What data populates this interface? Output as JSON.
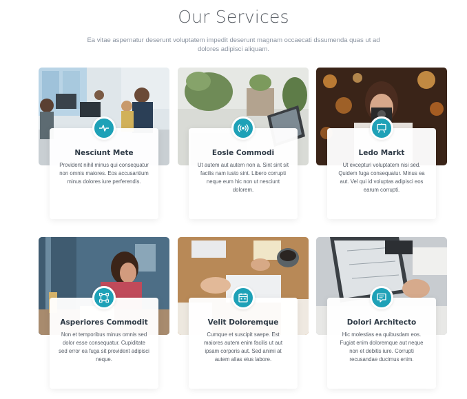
{
  "section": {
    "title": "Our Services",
    "description": "Ea vitae aspernatur deserunt voluptatem impedit deserunt magnam occaecati dssumenda quas ut ad dolores adipisci aliquam."
  },
  "services": [
    {
      "title": "Nesciunt Mete",
      "text": "Provident nihil minus qui consequatur non omnis maiores. Eos accusantium minus dolores iure perferendis.",
      "icon": "activity-icon"
    },
    {
      "title": "Eosle Commodi",
      "text": "Ut autem aut autem non a. Sint sint sit facilis nam iusto sint. Libero corrupti neque eum hic non ut nesciunt dolorem.",
      "icon": "broadcast-icon"
    },
    {
      "title": "Ledo Markt",
      "text": "Ut excepturi voluptatem nisi sed. Quidem fuga consequatur. Minus ea aut. Vel qui id voluptas adipisci eos earum corrupti.",
      "icon": "easel-icon"
    },
    {
      "title": "Asperiores Commodit",
      "text": "Non et temporibus minus omnis sed dolor esse consequatur. Cupiditate sed error ea fuga sit provident adipisci neque.",
      "icon": "bounding-box-icon"
    },
    {
      "title": "Velit Doloremque",
      "text": "Cumque et suscipit saepe. Est maiores autem enim facilis ut aut ipsam corporis aut. Sed animi at autem alias eius labore.",
      "icon": "calendar-icon"
    },
    {
      "title": "Dolori Architecto",
      "text": "Hic molestias ea quibusdam eos. Fugiat enim doloremque aut neque non et debitis iure. Corrupti recusandae ducimus enim.",
      "icon": "chat-icon"
    }
  ],
  "colors": {
    "accent": "#1ea1b7",
    "title": "#2e3a46",
    "text": "#555c66"
  }
}
